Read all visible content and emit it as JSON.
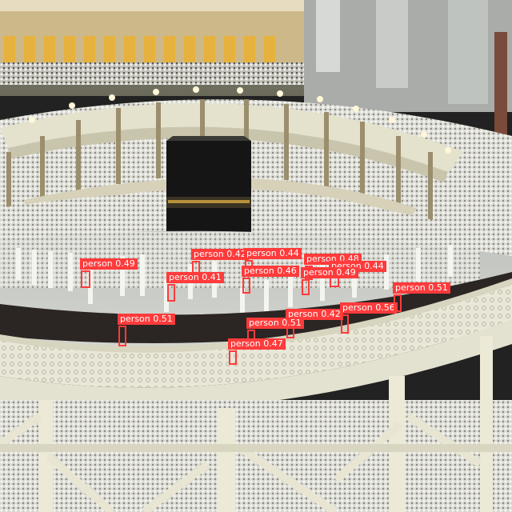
{
  "image": {
    "description_colors": {
      "sky": "#b8c6d0",
      "floor": "#c9cbc4",
      "balcony": "#e8e6d6",
      "kaaba": "#151515",
      "crowd_white": "#f2f2ee",
      "accent_gold": "#d9a030"
    }
  },
  "detections": [
    {
      "label": "person",
      "score": "0.49"
    },
    {
      "label": "person",
      "score": "0.42"
    },
    {
      "label": "person",
      "score": "0.44"
    },
    {
      "label": "person",
      "score": "0.48"
    },
    {
      "label": "person",
      "score": "0.44"
    },
    {
      "label": "person",
      "score": "0.41"
    },
    {
      "label": "person",
      "score": "0.46"
    },
    {
      "label": "person",
      "score": "0.49"
    },
    {
      "label": "person",
      "score": "0.51"
    },
    {
      "label": "person",
      "score": "0.56"
    },
    {
      "label": "person",
      "score": "0.42"
    },
    {
      "label": "person",
      "score": "0.51"
    },
    {
      "label": "person",
      "score": "0.51"
    },
    {
      "label": "person",
      "score": "0.47"
    }
  ],
  "box_color": "#ff3b3b"
}
